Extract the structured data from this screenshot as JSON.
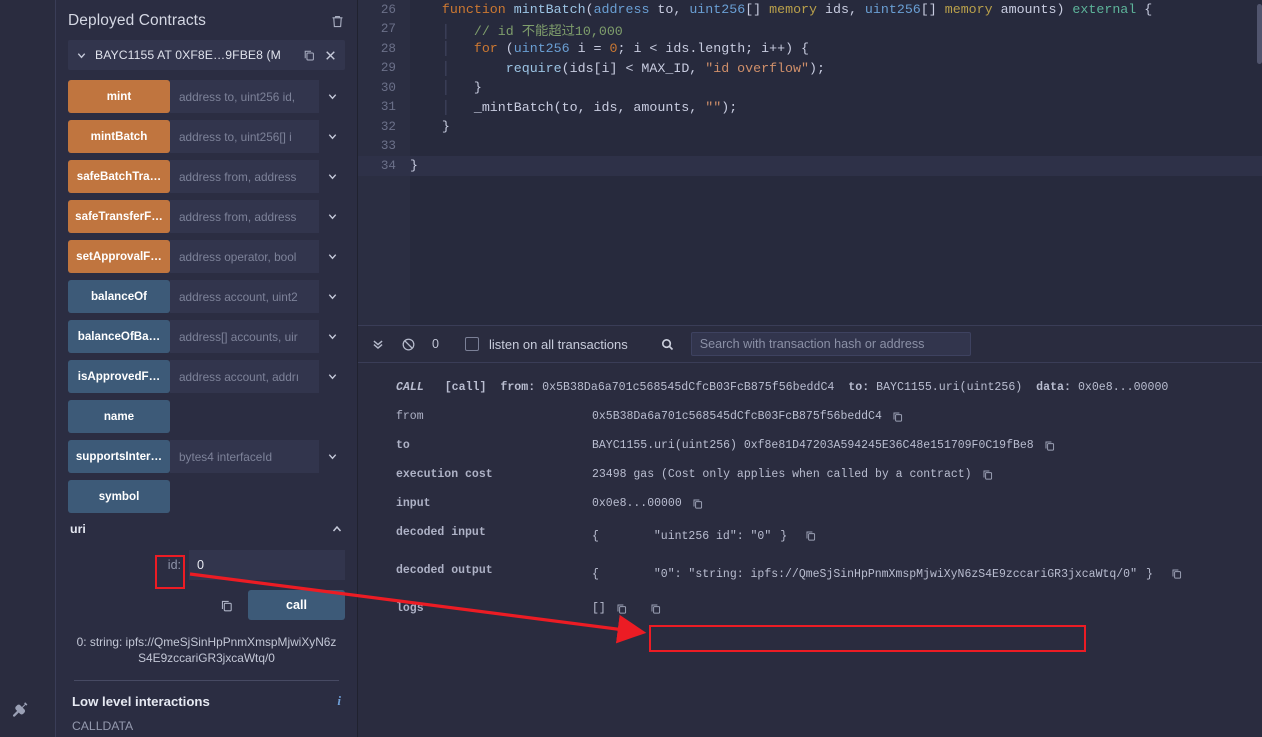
{
  "panel": {
    "title": "Deployed Contracts",
    "trash_icon": "trash-icon",
    "contract": {
      "name": "BAYC1155 AT 0XF8E…9FBE8 (M",
      "copy_icon": "copy-icon",
      "close_icon": "close-icon",
      "caret_icon": "chevron-down-icon"
    },
    "functions": [
      {
        "label": "mint",
        "color": "orange",
        "placeholder": "address to, uint256 id,",
        "expandable": true
      },
      {
        "label": "mintBatch",
        "color": "orange",
        "placeholder": "address to, uint256[] i",
        "expandable": true
      },
      {
        "label": "safeBatchTra…",
        "color": "orange",
        "placeholder": "address from, address",
        "expandable": true
      },
      {
        "label": "safeTransferF…",
        "color": "orange",
        "placeholder": "address from, address",
        "expandable": true
      },
      {
        "label": "setApprovalF…",
        "color": "orange",
        "placeholder": "address operator, bool",
        "expandable": true
      },
      {
        "label": "balanceOf",
        "color": "blue",
        "placeholder": "address account, uint2",
        "expandable": true
      },
      {
        "label": "balanceOfBa…",
        "color": "blue",
        "placeholder": "address[] accounts, uir",
        "expandable": true
      },
      {
        "label": "isApprovedF…",
        "color": "blue",
        "placeholder": "address account, addrı",
        "expandable": true
      },
      {
        "label": "name",
        "color": "blue",
        "placeholder": "",
        "expandable": false
      },
      {
        "label": "supportsInter…",
        "color": "blue",
        "placeholder": "bytes4 interfaceId",
        "expandable": true
      },
      {
        "label": "symbol",
        "color": "blue",
        "placeholder": "",
        "expandable": false
      }
    ],
    "uri_section": {
      "label": "uri",
      "collapse_icon": "chevron-up-icon",
      "param_label": "id:",
      "param_value": "0",
      "copy_icon": "copy-calldata-icon",
      "call_label": "call",
      "result": "0:  string: ipfs://QmeSjSinHpPnmXmspMjwiXyN6zS4E9zccariGR3jxcaWtq/0"
    },
    "low_level": {
      "title": "Low level interactions",
      "info_icon": "info-icon",
      "calldata_label": "CALLDATA"
    }
  },
  "rail": {
    "plugin_icon": "plug-icon"
  },
  "editor": {
    "lines": [
      {
        "num": "26",
        "active": false
      },
      {
        "num": "27",
        "active": false
      },
      {
        "num": "28",
        "active": false
      },
      {
        "num": "29",
        "active": false
      },
      {
        "num": "30",
        "active": false
      },
      {
        "num": "31",
        "active": false
      },
      {
        "num": "32",
        "active": false
      },
      {
        "num": "33",
        "active": false
      },
      {
        "num": "34",
        "active": true
      }
    ],
    "code": [
      "    function mintBatch(address to, uint256[] memory ids, uint256[] memory amounts) external {",
      "        // id 不能超过10,000",
      "        for (uint256 i = 0; i < ids.length; i++) {",
      "            require(ids[i] < MAX_ID, \"id overflow\");",
      "        }",
      "        _mintBatch(to, ids, amounts, \"\");",
      "    }",
      "",
      "}"
    ]
  },
  "terminal": {
    "toolbar": {
      "collapse_icon": "chevrons-down-icon",
      "clear_icon": "ban-icon",
      "count": "0",
      "listen_label": "listen on all transactions",
      "listen_checked": false,
      "search_icon": "search-icon",
      "search_placeholder": "Search with transaction hash or address",
      "search_value": ""
    },
    "tx": {
      "tag": "CALL",
      "kind": "[call]",
      "from_label": "from:",
      "from_value": "0x5B38Da6a701c568545dCfcB03FcB875f56beddC4",
      "to_label": "to:",
      "to_value": "BAYC1155.uri(uint256)",
      "data_label": "data:",
      "data_value": "0x0e8...00000"
    },
    "rows": [
      {
        "key": "from",
        "bold": false,
        "value": "0x5B38Da6a701c568545dCfcB03FcB875f56beddC4",
        "copy": true
      },
      {
        "key": "to",
        "bold": true,
        "value": "BAYC1155.uri(uint256) 0xf8e81D47203A594245E36C48e151709F0C19fBe8",
        "copy": true
      },
      {
        "key": "execution cost",
        "bold": true,
        "value": "23498 gas (Cost only applies when called by a contract)",
        "copy": true
      },
      {
        "key": "input",
        "bold": true,
        "value": "0x0e8...00000",
        "copy": true
      }
    ],
    "decoded_input": {
      "key": "decoded input",
      "open": "{",
      "body": "\"uint256 id\": \"0\"",
      "close": "}"
    },
    "decoded_output": {
      "key": "decoded output",
      "open": "{",
      "body": "\"0\": \"string: ipfs://QmeSjSinHpPnmXmspMjwiXyN6zS4E9zccariGR3jxcaWtq/0\"",
      "close": "}"
    },
    "logs": {
      "key": "logs",
      "value": "[]"
    }
  },
  "annotations": {
    "highlight_color": "#ec1c24",
    "arrow": "arrow-pointer",
    "boxes": [
      "id-input-highlight",
      "decoded-output-highlight"
    ]
  }
}
